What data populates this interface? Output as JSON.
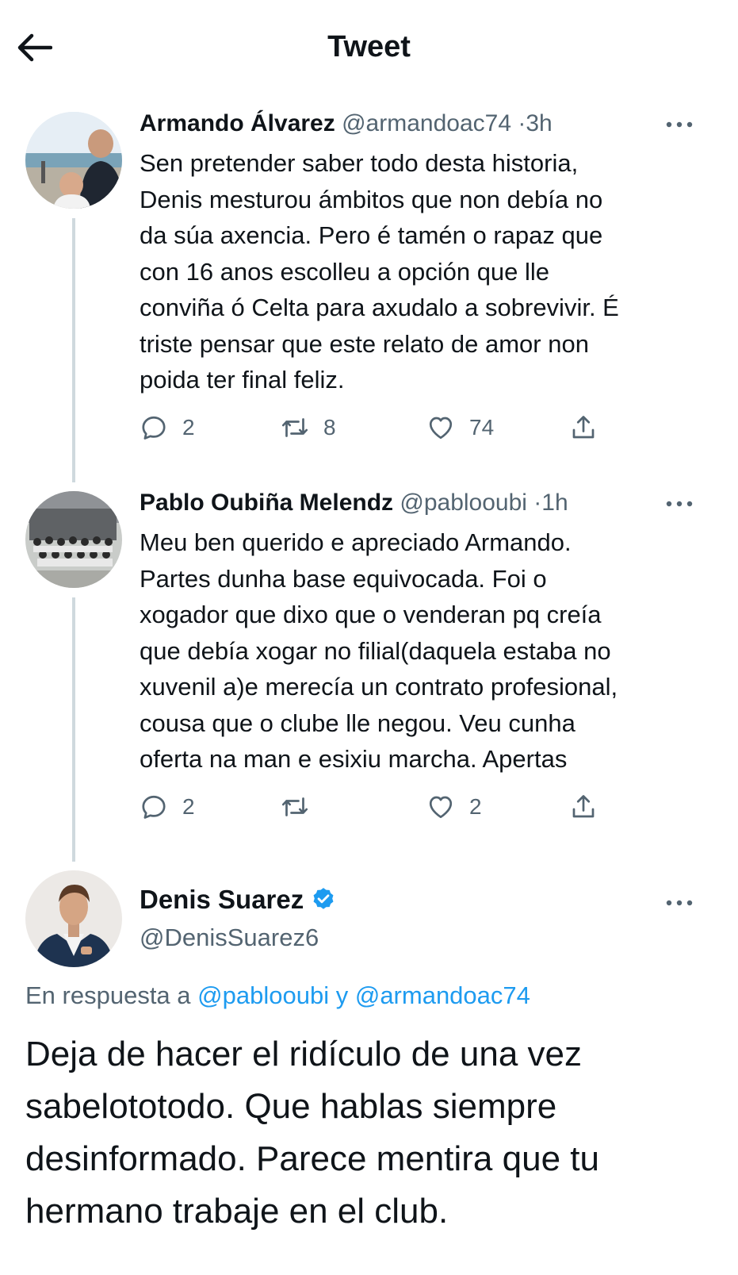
{
  "header": {
    "title": "Tweet"
  },
  "tweets": [
    {
      "name": "Armando Álvarez",
      "handle": "@armandoac74",
      "time": "3h",
      "lines": [
        "Sen pretender saber todo desta historia,",
        "Denis mesturou ámbitos que non debía no",
        "da súa axencia. Pero é tamén o rapaz que",
        "con 16 anos escolleu a opción que lle",
        "conviña ó Celta para axudalo a sobrevivir. É",
        "triste pensar que este relato de amor non",
        "poida ter final feliz."
      ],
      "replies": "2",
      "retweets": "8",
      "likes": "74"
    },
    {
      "name": "Pablo Oubiña Melendz",
      "handle": "@pablooubi",
      "time": "1h",
      "lines": [
        "Meu ben querido e apreciado Armando.",
        "Partes dunha base equivocada. Foi o",
        "xogador que dixo que o venderan pq creía",
        "que debía xogar no filial(daquela estaba no",
        "xuvenil a)e merecía un contrato profesional,",
        "cousa que o clube lle negou. Veu cunha",
        "oferta na man e esixiu marcha. Apertas"
      ],
      "replies": "2",
      "retweets": "",
      "likes": "2"
    }
  ],
  "main_tweet": {
    "name": "Denis Suarez",
    "handle": "@DenisSuarez6",
    "reply_prefix": "En respuesta a",
    "reply_user1": "@pablooubi",
    "reply_and": "y",
    "reply_user2": "@armandoac74",
    "lines": [
      "Deja de hacer el ridículo de una vez",
      "sabelototodo. Que hablas siempre",
      "desinformado. Parece mentira que tu",
      "hermano trabaje en el club."
    ]
  },
  "colors": {
    "text": "#0f1419",
    "secondary": "#536471",
    "link": "#1d9bf0",
    "verified": "#1d9bf0",
    "thread_line": "#cfd9de"
  },
  "icons": [
    "back-arrow-icon",
    "more-icon",
    "reply-icon",
    "retweet-icon",
    "like-icon",
    "share-icon",
    "verified-badge-icon"
  ]
}
